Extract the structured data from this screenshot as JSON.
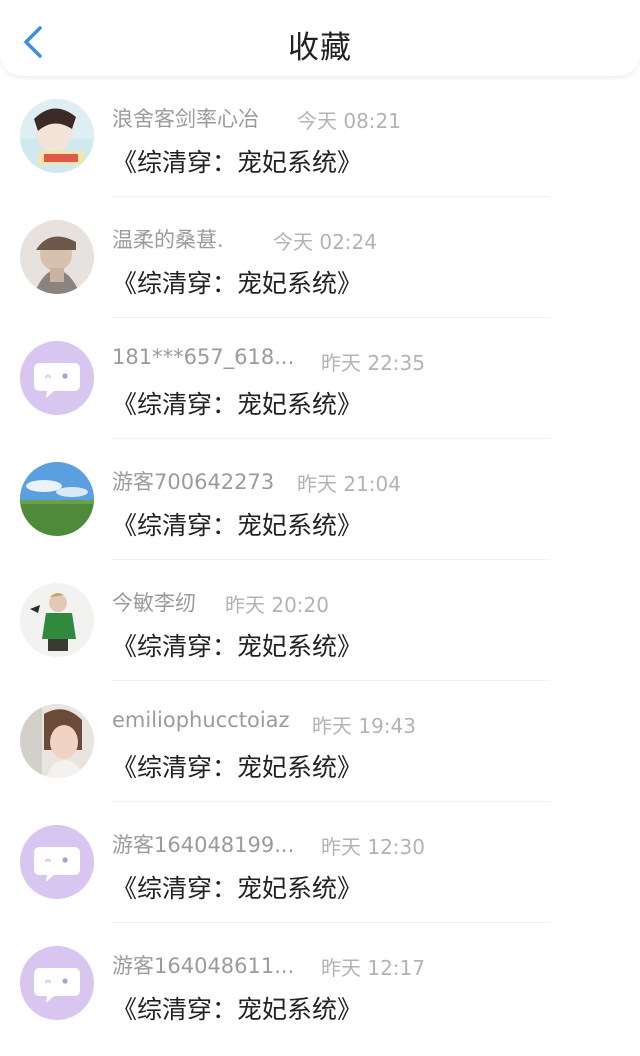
{
  "header": {
    "title": "收藏",
    "back_icon": "chevron-left-icon",
    "accent": "#3a8ee6"
  },
  "items": [
    {
      "user": "浪舍客剑率心冶",
      "time": "今天 08:21",
      "book": "《综清穿：宠妃系统》",
      "avatar": "photo-avatar"
    },
    {
      "user": "温柔的桑葚.",
      "time": "今天 02:24",
      "book": "《综清穿：宠妃系统》",
      "avatar": "photo-avatar"
    },
    {
      "user": "181***657_618...",
      "time": "昨天 22:35",
      "book": "《综清穿：宠妃系统》",
      "avatar": "default-chat-avatar"
    },
    {
      "user": "游客700642273",
      "time": "昨天 21:04",
      "book": "《综清穿：宠妃系统》",
      "avatar": "landscape-avatar"
    },
    {
      "user": "今敏李纫",
      "time": "昨天 20:20",
      "book": "《综清穿：宠妃系统》",
      "avatar": "photo-avatar"
    },
    {
      "user": "emiliophucctoiaz",
      "time": "昨天 19:43",
      "book": "《综清穿：宠妃系统》",
      "avatar": "photo-avatar"
    },
    {
      "user": "游客164048199...",
      "time": "昨天 12:30",
      "book": "《综清穿：宠妃系统》",
      "avatar": "default-chat-avatar"
    },
    {
      "user": "游客164048611...",
      "time": "昨天 12:17",
      "book": "《综清穿：宠妃系统》",
      "avatar": "default-chat-avatar"
    }
  ],
  "colors": {
    "default_avatar_bg": "#d9c6f0",
    "default_avatar_icon": "#ffffff"
  }
}
